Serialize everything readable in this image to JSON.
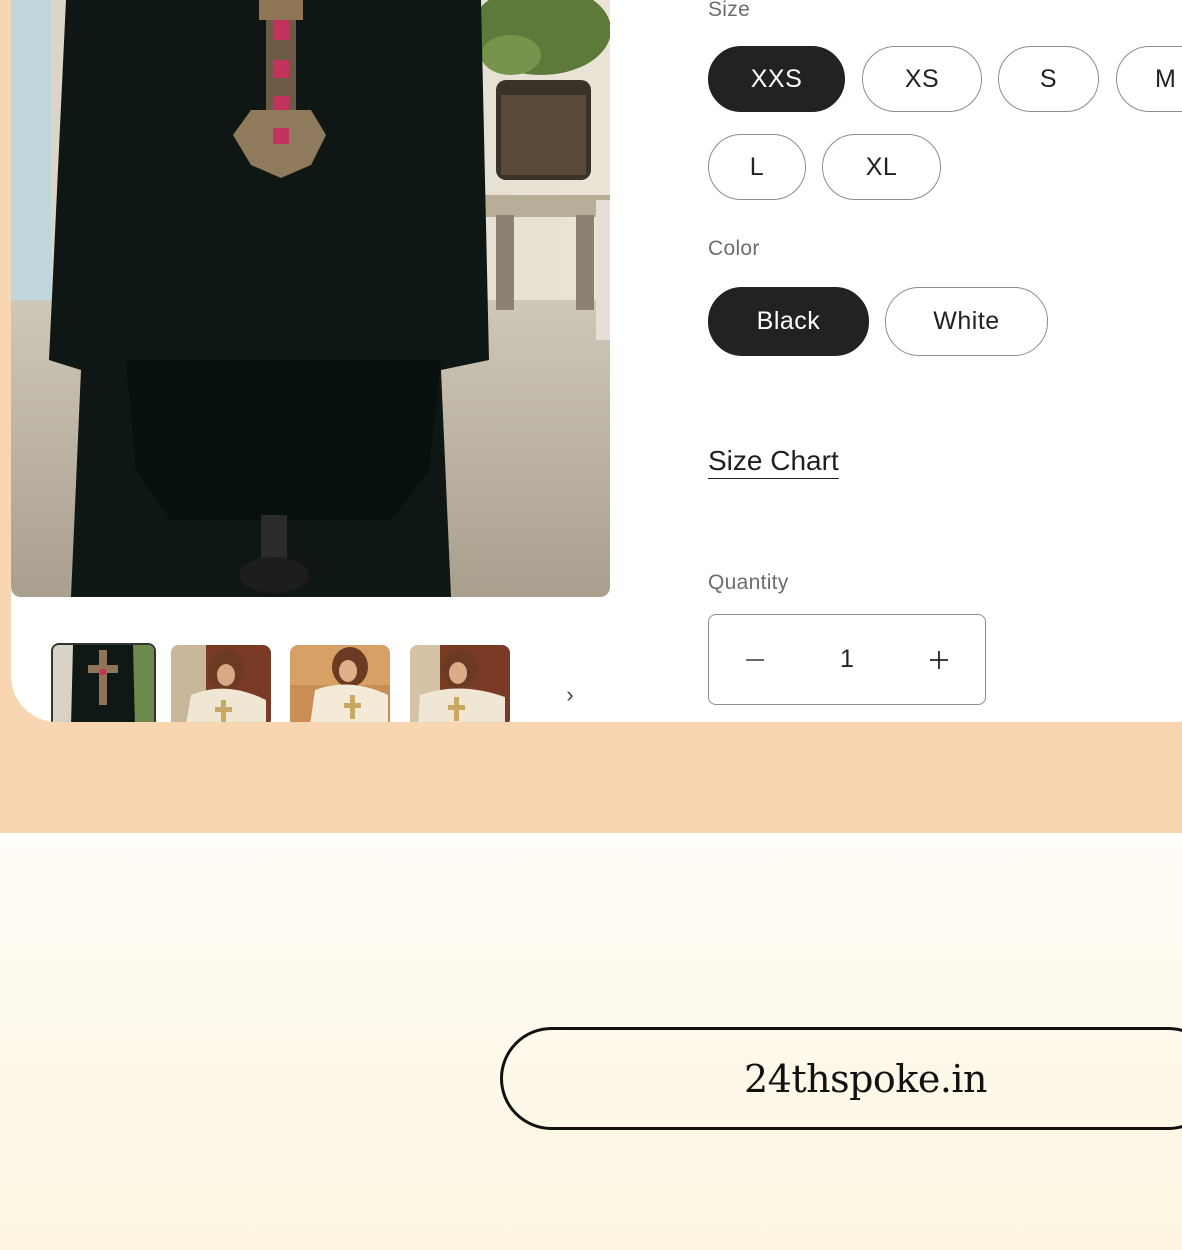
{
  "product": {
    "size": {
      "label": "Size",
      "options": [
        "XXS",
        "XS",
        "S",
        "M",
        "L",
        "XL"
      ],
      "selected": "XXS"
    },
    "color": {
      "label": "Color",
      "options": [
        "Black",
        "White"
      ],
      "selected": "Black"
    },
    "size_chart_link": "Size Chart",
    "quantity": {
      "label": "Quantity",
      "value": "1",
      "decrease_icon": "minus-icon",
      "increase_icon": "plus-icon"
    }
  },
  "gallery": {
    "next_icon": "chevron-right-icon"
  },
  "footer": {
    "domain": "24thspoke.in"
  },
  "colors": {
    "top_background": "#f8d6b2",
    "bottom_background": "#fdf6e6",
    "selected_pill": "#222222"
  }
}
